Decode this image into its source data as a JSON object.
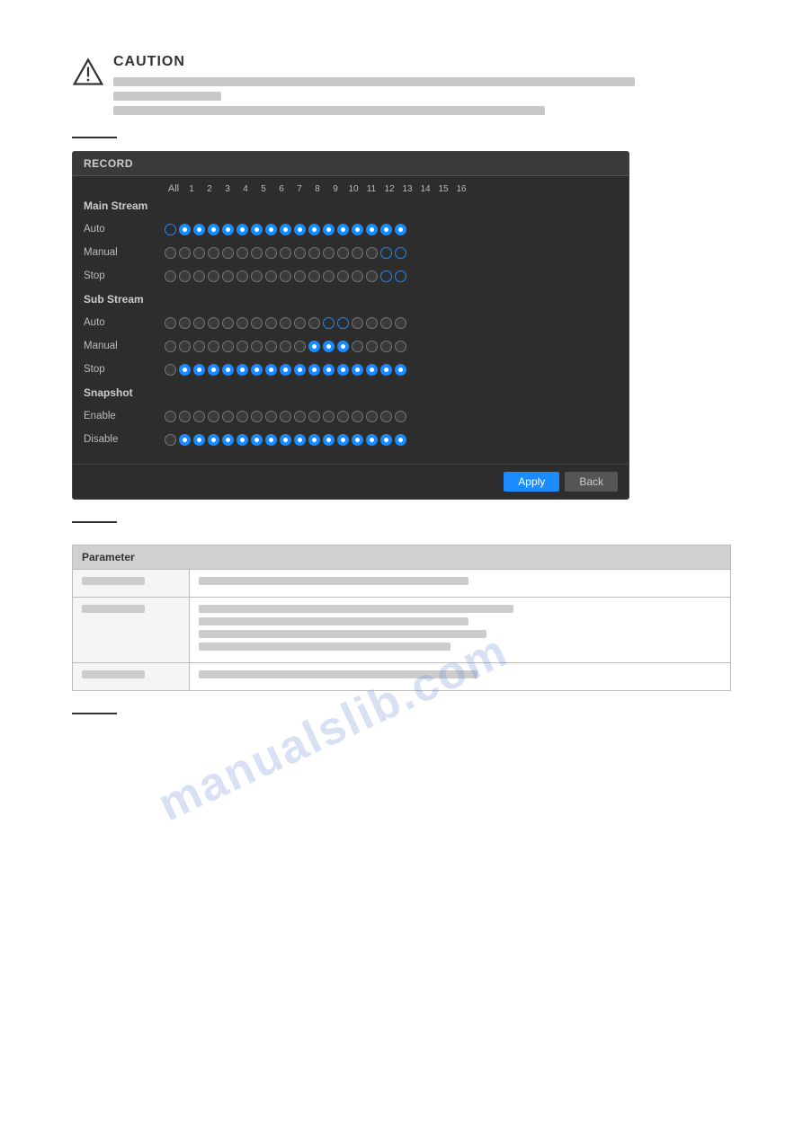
{
  "caution": {
    "title": "CAUTION",
    "lines": [
      "long",
      "short",
      "medium"
    ]
  },
  "record_panel": {
    "title": "RECORD",
    "channel_headers": {
      "all_label": "All",
      "numbers": [
        "1",
        "2",
        "3",
        "4",
        "5",
        "6",
        "7",
        "8",
        "9",
        "10",
        "11",
        "12",
        "13",
        "14",
        "15",
        "16"
      ]
    },
    "main_stream_label": "Main Stream",
    "sub_stream_label": "Sub Stream",
    "snapshot_label": "Snapshot",
    "rows": [
      {
        "label": "Auto",
        "section": "main"
      },
      {
        "label": "Manual",
        "section": "main"
      },
      {
        "label": "Stop",
        "section": "main"
      },
      {
        "label": "Auto",
        "section": "sub"
      },
      {
        "label": "Manual",
        "section": "sub"
      },
      {
        "label": "Stop",
        "section": "sub"
      },
      {
        "label": "Enable",
        "section": "snapshot"
      },
      {
        "label": "Disable",
        "section": "snapshot"
      }
    ],
    "apply_label": "Apply",
    "back_label": "Back"
  },
  "table": {
    "header": "Parameter",
    "rows": [
      {
        "label": "",
        "content_lines": [
          1
        ]
      },
      {
        "label": "",
        "content_lines": [
          3
        ]
      },
      {
        "label": "",
        "content_lines": [
          1
        ]
      }
    ]
  }
}
